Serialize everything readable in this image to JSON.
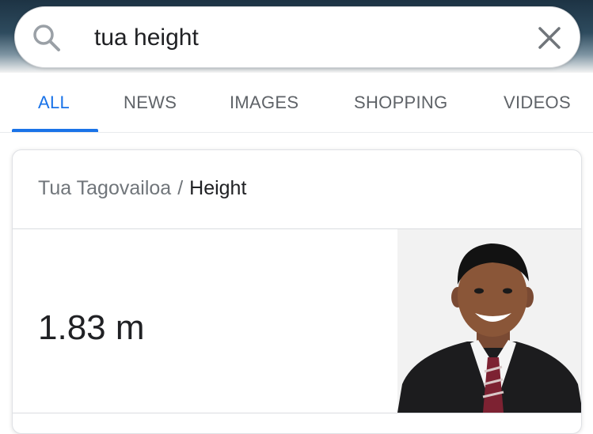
{
  "search": {
    "query": "tua height",
    "search_icon": "search-icon",
    "clear_icon": "close-icon"
  },
  "tabs": [
    {
      "label": "ALL",
      "active": true
    },
    {
      "label": "NEWS",
      "active": false
    },
    {
      "label": "IMAGES",
      "active": false
    },
    {
      "label": "SHOPPING",
      "active": false
    },
    {
      "label": "VIDEOS",
      "active": false
    }
  ],
  "answer_card": {
    "entity": "Tua Tagovailoa",
    "separator": "/",
    "attribute": "Height",
    "value": "1.83 m",
    "photo_icon": "person-photo"
  },
  "colors": {
    "accent": "#1a73e8",
    "text_primary": "#202124",
    "text_secondary": "#5f6368"
  }
}
